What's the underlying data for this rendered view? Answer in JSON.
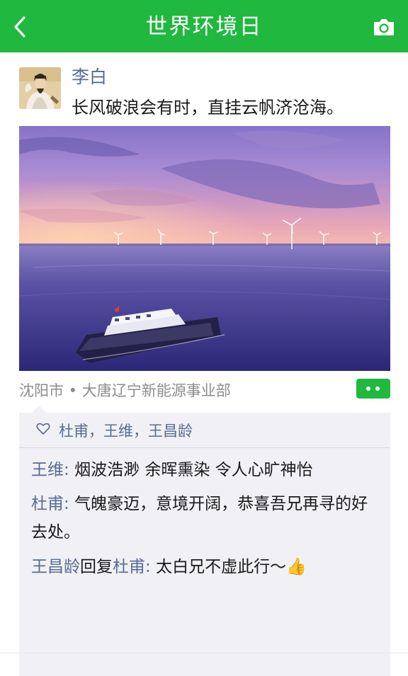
{
  "header": {
    "title": "世界环境日",
    "back_icon": "chevron-left-icon",
    "camera_icon": "camera-icon",
    "bar_color": "#20b83f"
  },
  "post": {
    "author": "李白",
    "text": "长风破浪会有时，直挂云帆济沧海。",
    "location": "沈阳市 • 大唐辽宁新能源事业部",
    "more_icon": "more-dots-icon"
  },
  "likes": {
    "icon": "heart-icon",
    "names": "杜甫，王维，王昌龄"
  },
  "comments": [
    {
      "name": "王维",
      "sep": ": ",
      "text": "烟波浩渺 余晖熏染 令人心旷神怡"
    },
    {
      "name": "杜甫",
      "sep": ":  ",
      "text": "气魄豪迈，意境开阔，恭喜吾兄再寻的好去处。"
    },
    {
      "name": "王昌龄",
      "reply": "回复",
      "target": "杜甫",
      "sep": ": ",
      "text": "太白兄不虚此行～👍"
    }
  ],
  "colors": {
    "accent": "#20b83f",
    "name_link": "#576b95",
    "muted": "#8c8c8c",
    "comment_bg": "#f1f1f5"
  }
}
